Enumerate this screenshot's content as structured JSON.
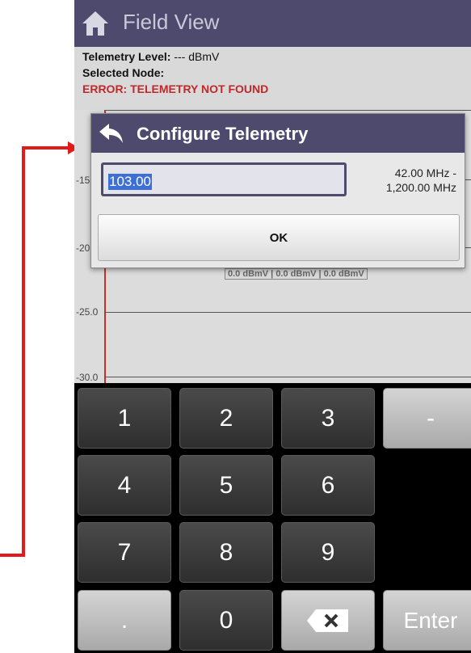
{
  "header": {
    "title": "Field View",
    "home_icon": "home-icon"
  },
  "info": {
    "telemetry_level_label": "Telemetry Level:",
    "telemetry_level_value": "--- dBmV",
    "selected_node_label": "Selected Node:",
    "error_text": "ERROR: TELEMETRY NOT FOUND"
  },
  "plot": {
    "y_ticks": [
      "-15",
      "-20",
      "-25.0",
      "-30.0"
    ],
    "values_text": "0.0 dBmV | 0.0 dBmV | 0.0 dBmV"
  },
  "dialog": {
    "title": "Configure Telemetry",
    "back_icon": "back-arrow-icon",
    "frequency_value": "103.00",
    "range_line1": "42.00 MHz -",
    "range_line2": "1,200.00 MHz",
    "ok_label": "OK"
  },
  "keypad": {
    "keys": [
      "1",
      "2",
      "3",
      "-",
      "4",
      "5",
      "6",
      "7",
      "8",
      "9",
      ".",
      "0",
      "Enter"
    ],
    "backspace_icon": "backspace-icon"
  },
  "colors": {
    "header": "#4d4a6e",
    "error": "#c0282a",
    "pointer": "#e41a1a",
    "selection": "#3d6fd6"
  }
}
